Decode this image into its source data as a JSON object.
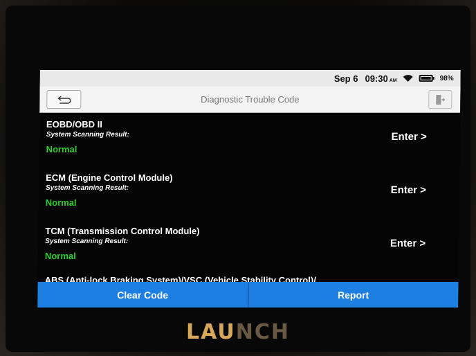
{
  "status_bar": {
    "date": "Sep 6",
    "time": "09:30",
    "ampm": "AM",
    "battery_percent_label": "98%",
    "battery_level": 0.98,
    "icons": [
      "wifi-icon",
      "battery-icon"
    ]
  },
  "title_bar": {
    "title": "Diagnostic Trouble Code",
    "left_icon": "back-arrow-icon",
    "right_icon": "exit-icon"
  },
  "systems": [
    {
      "name": "EOBD/OBD II",
      "sub_label": "System Scanning Result:",
      "status": "Normal",
      "action": "Enter >"
    },
    {
      "name": "ECM (Engine Control Module)",
      "sub_label": "System Scanning Result:",
      "status": "Normal",
      "action": "Enter >"
    },
    {
      "name": "TCM (Transmission Control Module)",
      "sub_label": "System Scanning Result:",
      "status": "Normal",
      "action": "Enter >"
    }
  ],
  "partial_item": "ABS (Anti-lock Braking System)/VSC (Vehicle Stability Control)/",
  "actions": {
    "clear_code": "Clear Code",
    "report": "Report"
  },
  "brand": {
    "lit": "LAU",
    "dim": "NCH"
  },
  "colors": {
    "status_normal": "#2ccf2c",
    "action_blue": "#1e7fe3"
  }
}
